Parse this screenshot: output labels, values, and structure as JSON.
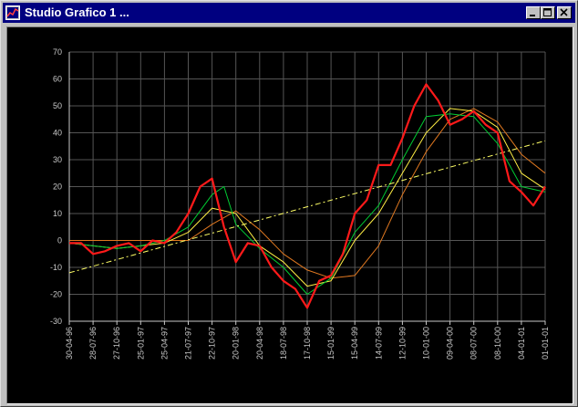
{
  "window": {
    "title": "Studio Grafico 1 ...",
    "icon": "chart-app-icon",
    "controls": [
      "minimize-icon",
      "maximize-icon",
      "close-icon"
    ]
  },
  "colors": {
    "background": "#000000",
    "grid": "#555555",
    "price": "#ff1a1a",
    "ma_short": "#00cc33",
    "ma_medium": "#ffee44",
    "ma_long": "#e07820",
    "trend": "#ffff66",
    "axis_text": "#c8c8c8"
  },
  "chart_data": {
    "type": "line",
    "grid": true,
    "ylim": [
      -30,
      70
    ],
    "yticks": [
      -30,
      -20,
      -10,
      0,
      10,
      20,
      30,
      40,
      50,
      60,
      70
    ],
    "xlim": [
      0,
      20
    ],
    "x_tick_labels": [
      "30-04-96",
      "28-07-96",
      "27-10-96",
      "25-01-97",
      "25-04-97",
      "21-07-97",
      "22-10-97",
      "20-01-98",
      "20-04-98",
      "18-07-98",
      "17-10-98",
      "15-01-99",
      "15-04-99",
      "14-07-99",
      "12-10-99",
      "10-01-00",
      "09-04-00",
      "08-07-00",
      "08-10-00",
      "04-01-01",
      "01-01-01"
    ],
    "series": [
      {
        "role": "price",
        "color": "#ff1a1a",
        "x": [
          0,
          0.5,
          1,
          1.5,
          2,
          2.5,
          3,
          3.5,
          4,
          4.5,
          5,
          5.5,
          6,
          6.5,
          7,
          7.5,
          8,
          8.5,
          9,
          9.5,
          10,
          10.5,
          11,
          11.5,
          12,
          12.5,
          13,
          13.5,
          14,
          14.5,
          15,
          15.5,
          16,
          16.5,
          17,
          17.5,
          18,
          18.5,
          19,
          19.5,
          20
        ],
        "y": [
          -1,
          -1,
          -5,
          -4,
          -2,
          -1,
          -4,
          0,
          -1,
          3,
          10,
          20,
          23,
          5,
          -8,
          -1,
          -2,
          -10,
          -15,
          -18,
          -25,
          -15,
          -13,
          -5,
          10,
          15,
          28,
          28,
          38,
          50,
          58,
          52,
          43,
          45,
          48,
          43,
          40,
          22,
          18,
          13,
          20
        ]
      },
      {
        "role": "ma_short",
        "color": "#00cc33",
        "x": [
          0,
          1,
          2,
          3,
          4,
          5,
          6,
          6.5,
          7,
          8,
          9,
          10,
          11,
          12,
          13,
          14,
          15,
          16,
          17,
          18,
          19,
          20
        ],
        "y": [
          -1,
          -2,
          -3,
          -2,
          0,
          5,
          17,
          20,
          6,
          -3,
          -10,
          -20,
          -14,
          3,
          13,
          30,
          46,
          47,
          46,
          36,
          20,
          18
        ]
      },
      {
        "role": "ma_medium",
        "color": "#ffee44",
        "x": [
          0,
          1,
          2,
          3,
          4,
          5,
          6,
          7,
          8,
          9,
          10,
          11,
          12,
          13,
          14,
          15,
          16,
          17,
          18,
          19,
          20
        ],
        "y": [
          -1,
          -2,
          -3,
          -2,
          -1,
          3,
          12,
          10,
          -2,
          -8,
          -17,
          -15,
          0,
          10,
          25,
          40,
          49,
          48,
          42,
          25,
          19
        ]
      },
      {
        "role": "ma_long",
        "color": "#e07820",
        "x": [
          0,
          1,
          2,
          3,
          4,
          5,
          6,
          7,
          8,
          9,
          10,
          11,
          12,
          13,
          14,
          15,
          16,
          17,
          18,
          19,
          20
        ],
        "y": [
          0,
          0,
          0,
          0,
          0,
          0,
          6,
          11,
          4,
          -5,
          -11,
          -14,
          -13,
          -2,
          17,
          33,
          45,
          49,
          44,
          32,
          25
        ]
      },
      {
        "role": "trend",
        "color": "#ffff66",
        "x": [
          0,
          20
        ],
        "y": [
          -12,
          37
        ]
      }
    ]
  }
}
